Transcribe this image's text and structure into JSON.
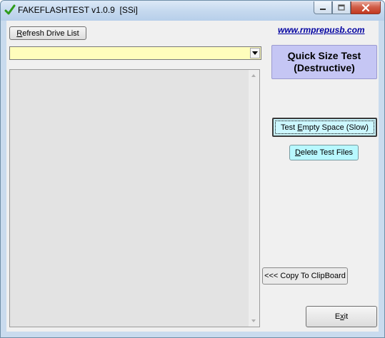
{
  "window": {
    "title": "FAKEFLASHTEST v1.0.9  [SSi]",
    "controls": {
      "minimize": "minimize",
      "maximize": "maximize",
      "close": "close"
    }
  },
  "toolbar": {
    "refresh_label_accel": "R",
    "refresh_label_rest": "efresh Drive List",
    "website": "www.rmprepusb.com"
  },
  "drive_select": {
    "value": ""
  },
  "actions": {
    "quick_line1_accel": "Q",
    "quick_line1_rest": "uick Size Test",
    "quick_line2": "(Destructive)",
    "test_empty_pre": "Test ",
    "test_empty_accel": "E",
    "test_empty_rest": "mpty Space (Slow)",
    "delete_accel": "D",
    "delete_rest": "elete Test Files",
    "copy_clipboard": "<<< Copy To ClipBoard",
    "exit_pre": "E",
    "exit_accel": "x",
    "exit_rest": "it"
  },
  "colors": {
    "combo_bg": "#fffdbc",
    "quick_bg": "#c5c6f4",
    "test_empty_bg": "#ccf7ff",
    "delete_bg": "#b8f8ff",
    "link": "#0000a0"
  }
}
